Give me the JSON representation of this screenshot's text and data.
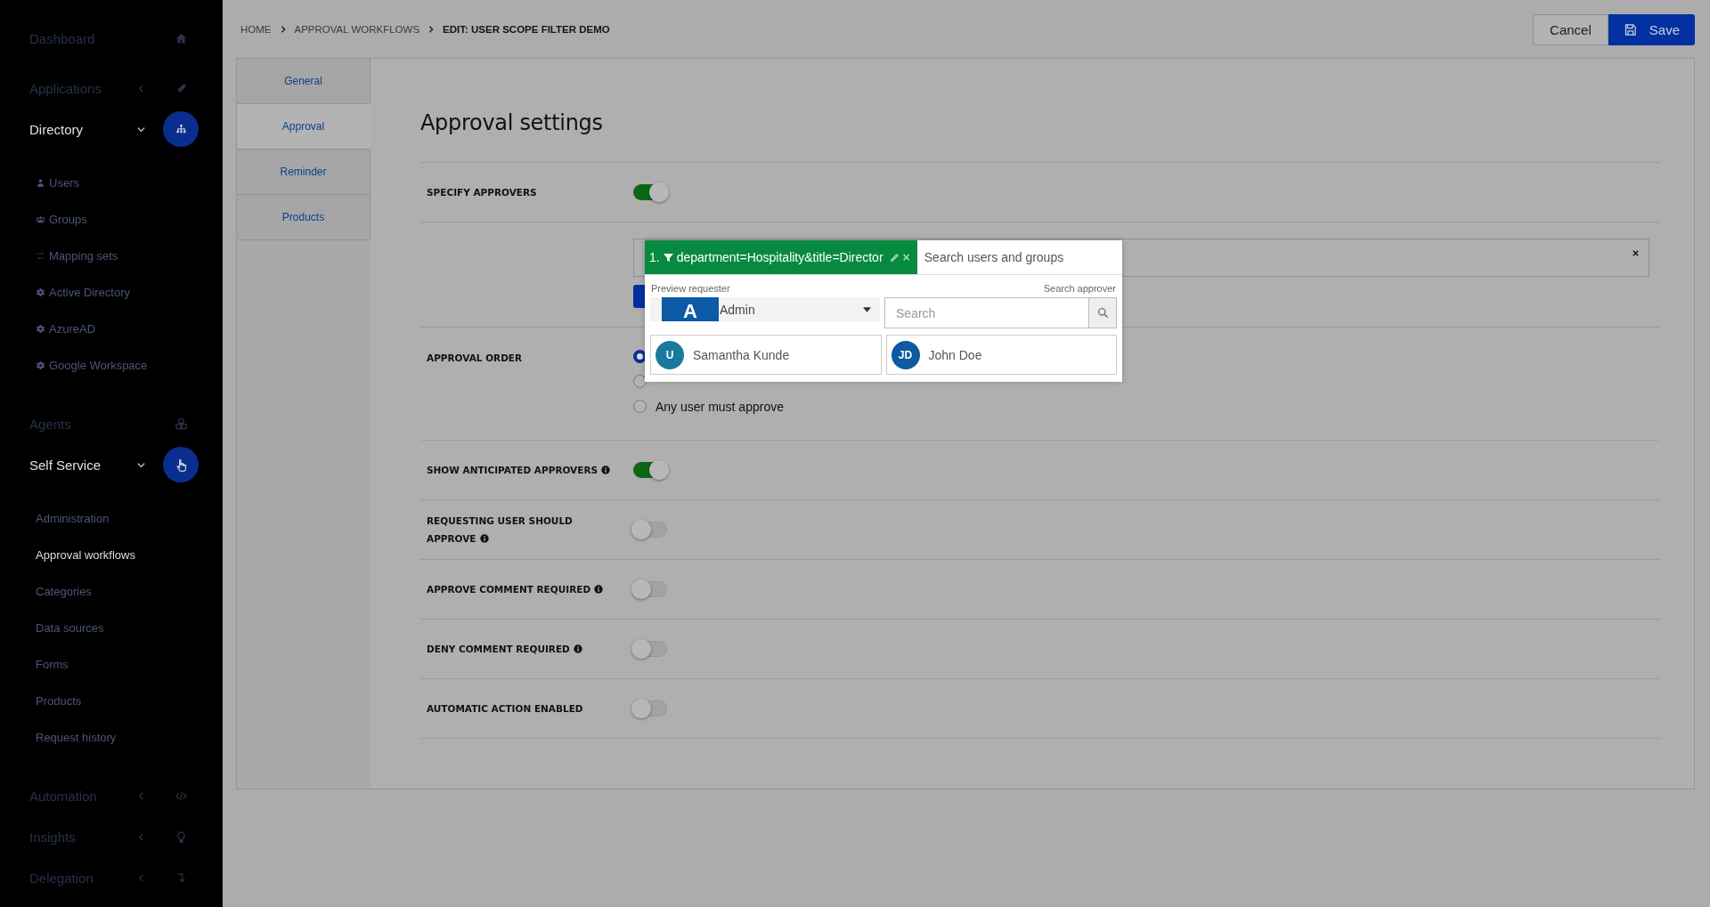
{
  "sidebar": {
    "items": [
      {
        "label": "Dashboard",
        "active": false
      },
      {
        "label": "Applications",
        "active": false,
        "expanded": false
      },
      {
        "label": "Directory",
        "active": true,
        "expanded": true,
        "children": [
          {
            "label": "Users",
            "selected": false
          },
          {
            "label": "Groups",
            "selected": false
          },
          {
            "label": "Mapping sets",
            "selected": false
          },
          {
            "label": "Active Directory",
            "selected": false
          },
          {
            "label": "AzureAD",
            "selected": false
          },
          {
            "label": "Google Workspace",
            "selected": false
          }
        ]
      },
      {
        "label": "Agents",
        "active": false
      },
      {
        "label": "Self Service",
        "active": true,
        "expanded": true,
        "children": [
          {
            "label": "Administration",
            "selected": false
          },
          {
            "label": "Approval workflows",
            "selected": true
          },
          {
            "label": "Categories",
            "selected": false
          },
          {
            "label": "Data sources",
            "selected": false
          },
          {
            "label": "Forms",
            "selected": false
          },
          {
            "label": "Products",
            "selected": false
          },
          {
            "label": "Request history",
            "selected": false
          }
        ]
      },
      {
        "label": "Automation",
        "active": false,
        "expanded": false
      },
      {
        "label": "Insights",
        "active": false,
        "expanded": false
      },
      {
        "label": "Delegation",
        "active": false,
        "expanded": false
      }
    ]
  },
  "breadcrumb": [
    "HOME",
    "APPROVAL WORKFLOWS",
    "EDIT: USER SCOPE FILTER DEMO"
  ],
  "buttons": {
    "cancel": "Cancel",
    "save": "Save"
  },
  "tabs": [
    {
      "label": "General",
      "selected": false
    },
    {
      "label": "Approval",
      "selected": true
    },
    {
      "label": "Reminder",
      "selected": false
    },
    {
      "label": "Products",
      "selected": false
    }
  ],
  "title": "Approval settings",
  "rows": [
    {
      "kind": "toggle",
      "label": "SPECIFY APPROVERS",
      "info": false,
      "on": true
    },
    {
      "kind": "approvers"
    },
    {
      "kind": "radios",
      "label": "APPROVAL ORDER",
      "options": [
        {
          "selected": true
        },
        {
          "selected": false
        },
        {
          "label": "Any user must approve",
          "selected": false
        }
      ]
    },
    {
      "kind": "toggle",
      "label": "SHOW ANTICIPATED APPROVERS",
      "info": true,
      "on": true
    },
    {
      "kind": "toggle",
      "label": "REQUESTING USER SHOULD APPROVE",
      "info": true,
      "on": false
    },
    {
      "kind": "toggle",
      "label": "APPROVE COMMENT REQUIRED",
      "info": true,
      "on": false
    },
    {
      "kind": "toggle",
      "label": "DENY COMMENT REQUIRED",
      "info": true,
      "on": false
    },
    {
      "kind": "toggle",
      "label": "AUTOMATIC ACTION ENABLED",
      "info": false,
      "on": false
    }
  ],
  "popup": {
    "tag": {
      "number": "1.",
      "text": "department=Hospitality&title=Director",
      "remove": "×"
    },
    "search_placeholder": "Search users and groups",
    "preview_label": "Preview requester",
    "search_label": "Search approver",
    "requester": {
      "initial": "A",
      "name": "Admin"
    },
    "approver_search_placeholder": "Search",
    "approvers": [
      {
        "initials": "U",
        "name": "Samantha Kunde",
        "color": "#1a7a9c"
      },
      {
        "initials": "JD",
        "name": "John Doe",
        "color": "#0d5a9e"
      }
    ]
  }
}
